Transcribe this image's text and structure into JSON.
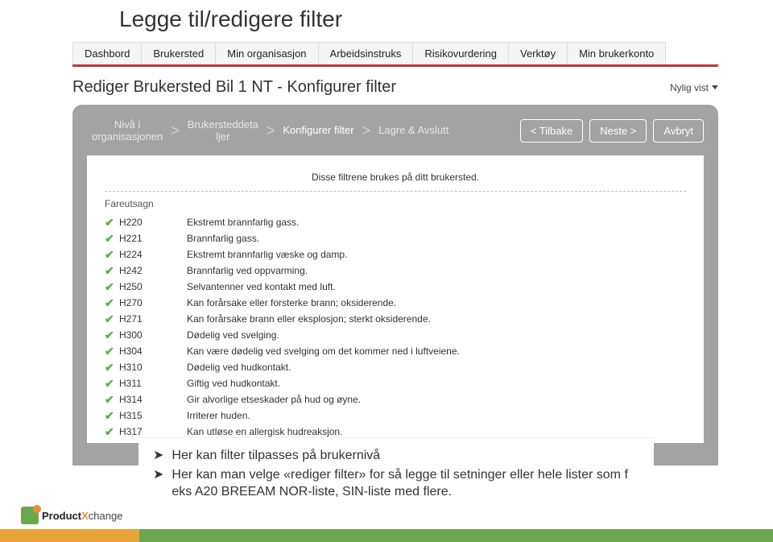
{
  "slide_title": "Legge til/redigere filter",
  "nav": {
    "tabs": [
      "Dashbord",
      "Brukersted",
      "Min organisasjon",
      "Arbeidsinstruks",
      "Risikovurdering",
      "Verktøy",
      "Min brukerkonto"
    ]
  },
  "page_heading": "Rediger Brukersted Bil 1 NT - Konfigurer filter",
  "recently_viewed_label": "Nylig vist",
  "breadcrumbs": {
    "step1_line1": "Nivå i",
    "step1_line2": "organisasjonen",
    "step2_line1": "Brukersteddeta",
    "step2_line2": "ljer",
    "step3": "Konfigurer filter",
    "step4": "Lagre & Avslutt"
  },
  "wizard_buttons": {
    "back": "< Tilbake",
    "next": "Neste >",
    "cancel": "Avbryt"
  },
  "filter_intro": "Disse filtrene brukes på ditt brukersted.",
  "section_label": "Fareutsagn",
  "rows": [
    {
      "code": "H220",
      "desc": "Ekstremt brannfarlig gass."
    },
    {
      "code": "H221",
      "desc": "Brannfarlig gass."
    },
    {
      "code": "H224",
      "desc": "Ekstremt brannfarlig væske og damp."
    },
    {
      "code": "H242",
      "desc": "Brannfarlig ved oppvarming."
    },
    {
      "code": "H250",
      "desc": "Selvantenner ved kontakt med luft."
    },
    {
      "code": "H270",
      "desc": "Kan forårsake eller forsterke brann; oksiderende."
    },
    {
      "code": "H271",
      "desc": "Kan forårsake brann eller eksplosjon; sterkt oksiderende."
    },
    {
      "code": "H300",
      "desc": "Dødelig ved svelging."
    },
    {
      "code": "H304",
      "desc": "Kan være dødelig ved svelging om det kommer ned i luftveiene."
    },
    {
      "code": "H310",
      "desc": "Dødelig ved hudkontakt."
    },
    {
      "code": "H311",
      "desc": "Giftig ved hudkontakt."
    },
    {
      "code": "H314",
      "desc": "Gir alvorlige etseskader på hud og øyne."
    },
    {
      "code": "H315",
      "desc": "Irriterer huden."
    },
    {
      "code": "H317",
      "desc": "Kan utløse en allergisk hudreaksjon."
    }
  ],
  "callout": {
    "line1": "Her kan filter tilpasses på brukernivå",
    "line2": "Her kan man velge «rediger filter» for så legge til setninger eller hele lister som f eks A20 BREEAM NOR-liste, SIN-liste med flere."
  },
  "logo": {
    "brand_prefix": "Product",
    "brand_x": "X",
    "brand_suffix": "change"
  }
}
